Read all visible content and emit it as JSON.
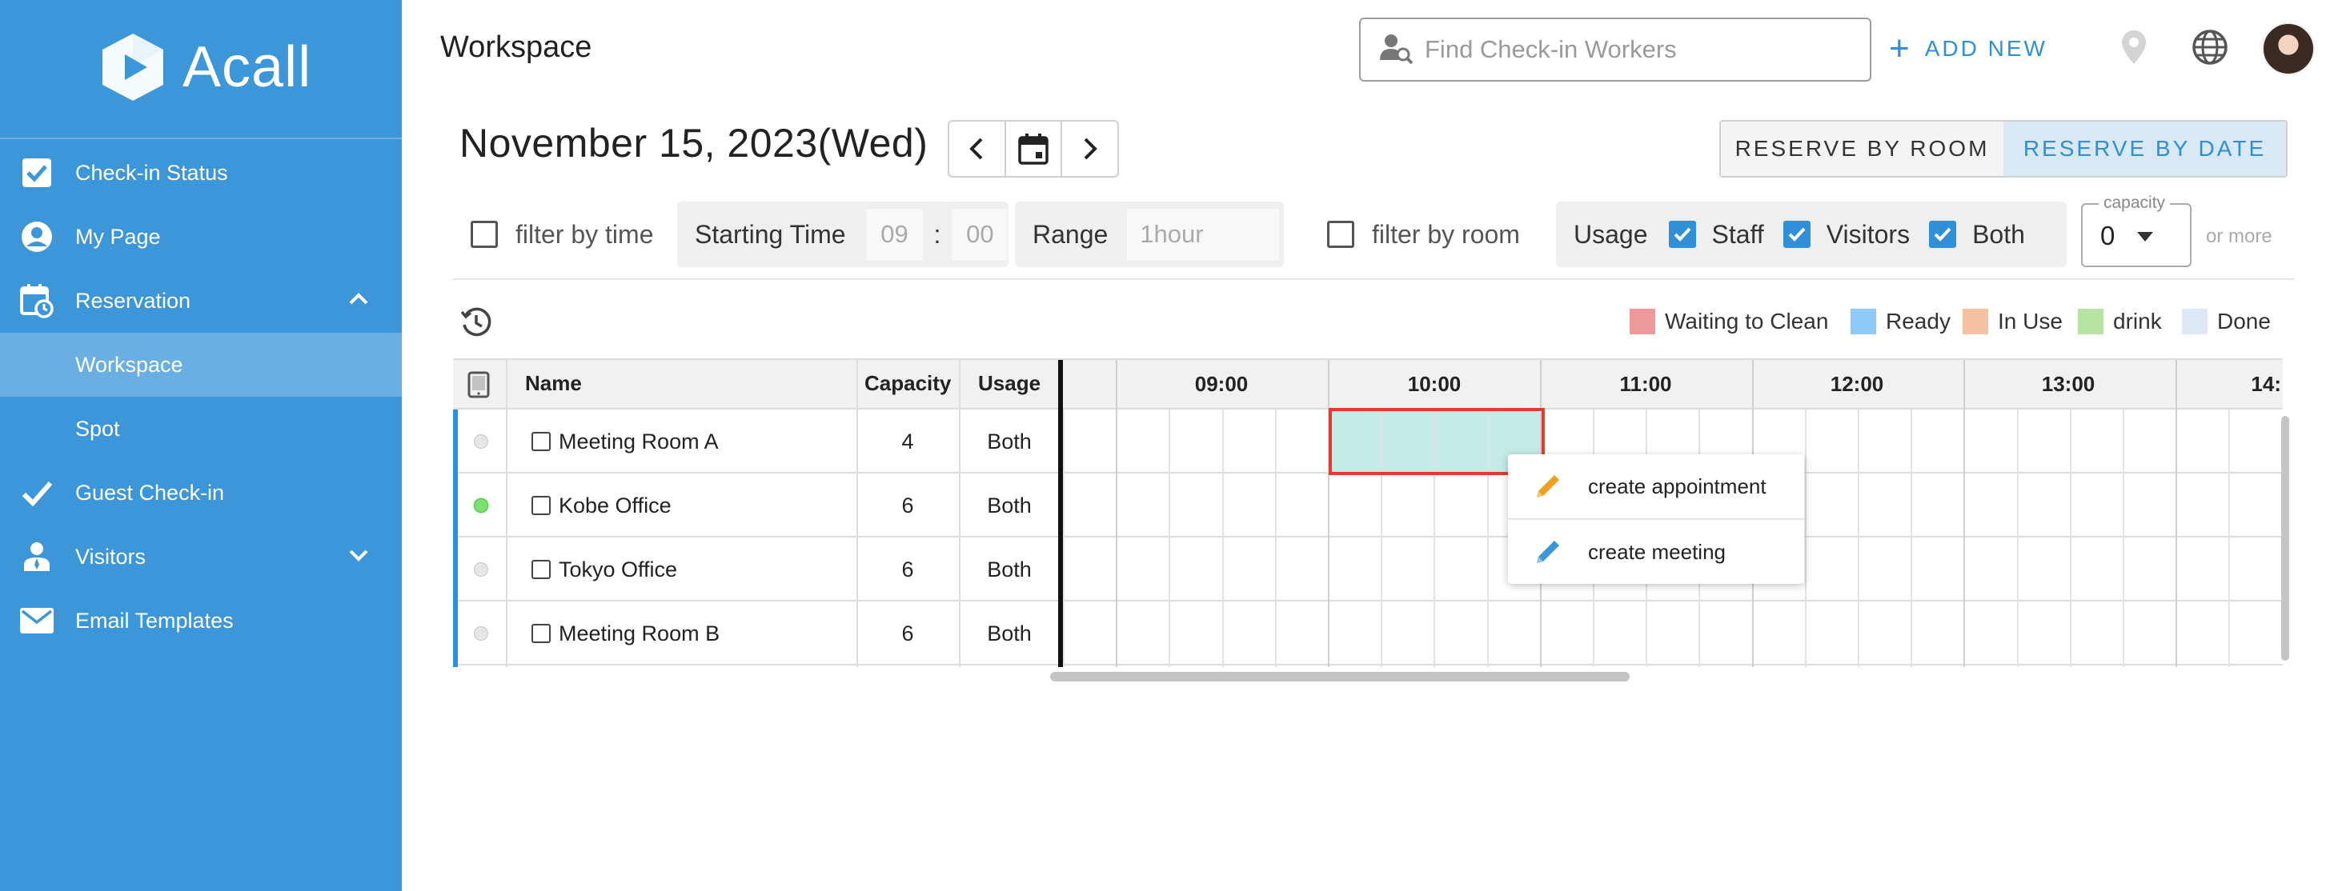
{
  "app": {
    "name": "Acall"
  },
  "sidebar": {
    "items": [
      {
        "label": "Check-in Status",
        "icon": "checkbox-icon"
      },
      {
        "label": "My Page",
        "icon": "user-icon"
      },
      {
        "label": "Reservation",
        "icon": "calendar-clock-icon",
        "expanded": true
      },
      {
        "label": "Workspace",
        "active": true
      },
      {
        "label": "Spot"
      },
      {
        "label": "Guest Check-in",
        "icon": "check-icon"
      },
      {
        "label": "Visitors",
        "icon": "visitor-icon",
        "expanded": false
      },
      {
        "label": "Email Templates",
        "icon": "mail-icon"
      }
    ]
  },
  "header": {
    "title": "Workspace",
    "search_placeholder": "Find Check-in Workers",
    "add_new": "ADD NEW"
  },
  "date_bar": {
    "date": "November 15, 2023(Wed)",
    "reserve_by_room": "RESERVE BY ROOM",
    "reserve_by_date": "RESERVE BY DATE",
    "active_mode": "reserve_by_date"
  },
  "filters": {
    "filter_by_time": "filter by time",
    "starting_time_label": "Starting Time",
    "hour": "09",
    "colon": ":",
    "minute": "00",
    "range_label": "Range",
    "range_value": "1hour",
    "filter_by_room": "filter by room",
    "usage_label": "Usage",
    "staff": "Staff",
    "visitors": "Visitors",
    "both": "Both",
    "capacity_label": "capacity",
    "capacity_value": "0",
    "or_more": "or more"
  },
  "legend": [
    {
      "label": "Waiting to Clean",
      "color": "#ef9a9a"
    },
    {
      "label": "Ready",
      "color": "#90caf9"
    },
    {
      "label": "In Use",
      "color": "#f5c1a0"
    },
    {
      "label": "drink",
      "color": "#b7e3a0"
    },
    {
      "label": "Done",
      "color": "#dde9f6"
    }
  ],
  "table": {
    "headers": {
      "name": "Name",
      "capacity": "Capacity",
      "usage": "Usage"
    },
    "times": [
      "09:00",
      "10:00",
      "11:00",
      "12:00",
      "13:00",
      "14:"
    ],
    "rows": [
      {
        "name": "Meeting Room A",
        "capacity": "4",
        "usage": "Both",
        "status": "off"
      },
      {
        "name": "Kobe Office",
        "capacity": "6",
        "usage": "Both",
        "status": "online"
      },
      {
        "name": "Tokyo Office",
        "capacity": "6",
        "usage": "Both",
        "status": "off"
      },
      {
        "name": "Meeting Room B",
        "capacity": "6",
        "usage": "Both",
        "status": "off"
      }
    ]
  },
  "context_menu": {
    "create_appointment": "create appointment",
    "create_meeting": "create meeting"
  },
  "colors": {
    "sidebar_bg": "#3d96d8",
    "sidebar_active": "#6aafe3",
    "accent": "#2f8fd8",
    "selection": "#c4ebe6",
    "selection_border": "#e53c2c"
  }
}
